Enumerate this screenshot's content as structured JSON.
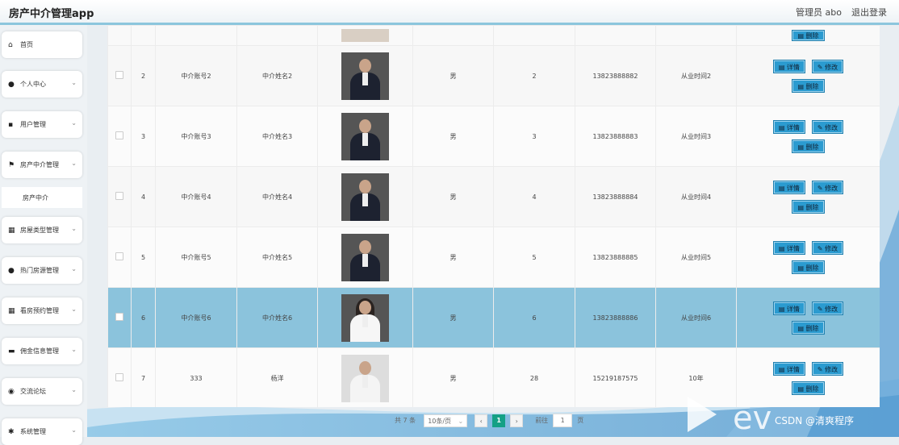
{
  "header": {
    "title": "房产中介管理app",
    "admin": "管理员 abo",
    "logout": "退出登录"
  },
  "sidebar": {
    "items": [
      {
        "label": "首页",
        "icon": "home-icon",
        "glyph": "⌂",
        "has_chevron": false
      },
      {
        "label": "个人中心",
        "icon": "user-icon",
        "glyph": "●",
        "has_chevron": true
      },
      {
        "label": "用户管理",
        "icon": "trash-icon",
        "glyph": "▪",
        "has_chevron": true
      },
      {
        "label": "房产中介管理",
        "icon": "flag-icon",
        "glyph": "⚑",
        "has_chevron": true
      },
      {
        "label": "房屋类型管理",
        "icon": "grid-icon",
        "glyph": "▦",
        "has_chevron": true
      },
      {
        "label": "热门房源管理",
        "icon": "person-icon",
        "glyph": "●",
        "has_chevron": true
      },
      {
        "label": "看房预约管理",
        "icon": "grid-icon",
        "glyph": "▦",
        "has_chevron": true
      },
      {
        "label": "佣金信息管理",
        "icon": "monitor-icon",
        "glyph": "▬",
        "has_chevron": true
      },
      {
        "label": "交流论坛",
        "icon": "location-icon",
        "glyph": "◉",
        "has_chevron": true
      },
      {
        "label": "系统管理",
        "icon": "settings-icon",
        "glyph": "✱",
        "has_chevron": true
      }
    ],
    "sub_item": "房产中介"
  },
  "table": {
    "partial_row": {
      "delete": "删除"
    },
    "rows": [
      {
        "index": "2",
        "account": "中介账号2",
        "name": "中介姓名2",
        "gender": "男",
        "age": "2",
        "phone": "13823888882",
        "work": "从业时间2",
        "photo": "dark"
      },
      {
        "index": "3",
        "account": "中介账号3",
        "name": "中介姓名3",
        "gender": "男",
        "age": "3",
        "phone": "13823888883",
        "work": "从业时间3",
        "photo": "dark"
      },
      {
        "index": "4",
        "account": "中介账号4",
        "name": "中介姓名4",
        "gender": "男",
        "age": "4",
        "phone": "13823888884",
        "work": "从业时间4",
        "photo": "dark"
      },
      {
        "index": "5",
        "account": "中介账号5",
        "name": "中介姓名5",
        "gender": "男",
        "age": "5",
        "phone": "13823888885",
        "work": "从业时间5",
        "photo": "dark"
      },
      {
        "index": "6",
        "account": "中介账号6",
        "name": "中介姓名6",
        "gender": "男",
        "age": "6",
        "phone": "13823888886",
        "work": "从业时间6",
        "photo": "woman"
      },
      {
        "index": "7",
        "account": "333",
        "name": "杨洋",
        "gender": "男",
        "age": "28",
        "phone": "15219187575",
        "work": "10年",
        "photo": "light"
      }
    ],
    "buttons": {
      "detail": "详情",
      "edit": "修改",
      "delete": "删除"
    }
  },
  "pager": {
    "total": "共 7 条",
    "page_size": "10条/页",
    "prev": "‹",
    "current": "1",
    "next": "›",
    "goto": "前往",
    "goto_value": "1",
    "unit": "页"
  },
  "watermark": "CSDN @清爽程序"
}
